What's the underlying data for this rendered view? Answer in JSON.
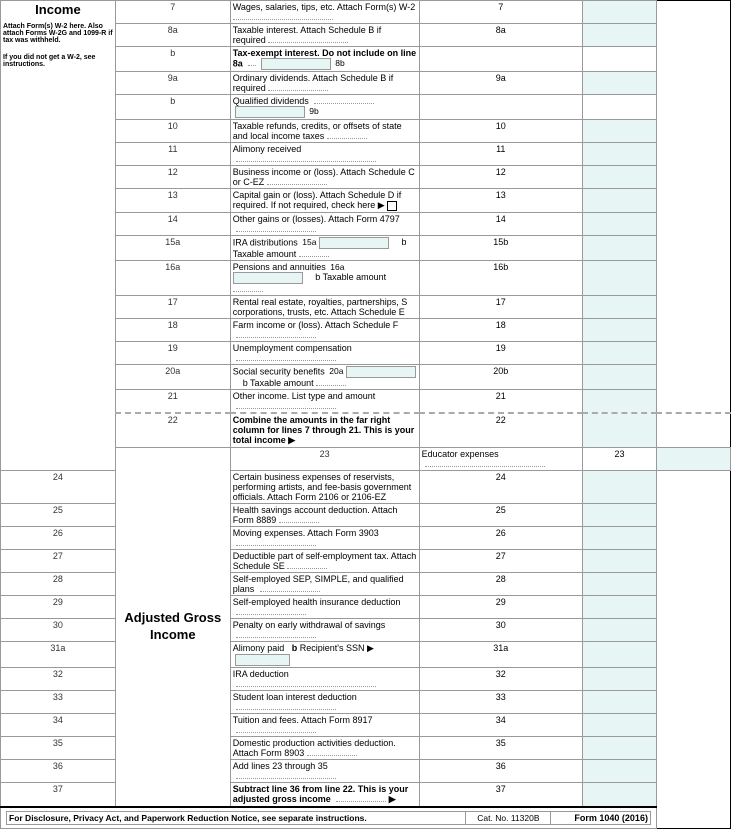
{
  "form": {
    "title": "Form 1040 (2016)",
    "catno": "Cat. No. 11320B",
    "footer_text": "For Disclosure, Privacy Act, and Paperwork Reduction Notice, see separate instructions."
  },
  "sections": {
    "income": {
      "label": "Income",
      "attach_note": "Attach Form(s) W-2 here. Also attach Forms W-2G and 1099-R if tax was withheld.",
      "w2_note": "If you did not get a W-2, see instructions."
    },
    "agi": {
      "label": "Adjusted Gross Income"
    }
  },
  "lines": [
    {
      "num": "7",
      "col_a": "",
      "desc": "Wages, salaries, tips, etc. Attach Form(s) W-2",
      "result_col": "7"
    },
    {
      "num": "8a",
      "col_a": "",
      "desc": "Taxable interest. Attach Schedule B if required",
      "result_col": "8a"
    },
    {
      "num": "b",
      "col_a": "8b",
      "desc": "Tax-exempt interest. Do not include on line 8a",
      "has_inline": true,
      "inline_label": "8b",
      "result_col": ""
    },
    {
      "num": "9a",
      "col_a": "",
      "desc": "Ordinary dividends. Attach Schedule B if required",
      "result_col": "9a"
    },
    {
      "num": "b",
      "col_a": "9b",
      "desc": "Qualified dividends",
      "has_inline": true,
      "inline_label": "9b",
      "result_col": ""
    },
    {
      "num": "10",
      "col_a": "",
      "desc": "Taxable refunds, credits, or offsets of state and local income taxes",
      "result_col": "10"
    },
    {
      "num": "11",
      "col_a": "",
      "desc": "Alimony received",
      "result_col": "11"
    },
    {
      "num": "12",
      "col_a": "",
      "desc": "Business income or (loss). Attach Schedule C or C-EZ",
      "result_col": "12"
    },
    {
      "num": "13",
      "col_a": "",
      "desc": "Capital gain or (loss). Attach Schedule D if required. If not required, check here ▶",
      "has_checkbox": true,
      "result_col": "13"
    },
    {
      "num": "14",
      "col_a": "",
      "desc": "Other gains or (losses). Attach Form 4797",
      "result_col": "14"
    },
    {
      "num": "15a",
      "col_a": "15a",
      "desc": "IRA distributions",
      "has_left_input": true,
      "right_label": "b Taxable amount",
      "result_col": "15b"
    },
    {
      "num": "16a",
      "col_a": "16a",
      "desc": "Pensions and annuities",
      "has_left_input": true,
      "right_label": "b Taxable amount",
      "result_col": "16b"
    },
    {
      "num": "17",
      "col_a": "",
      "desc": "Rental real estate, royalties, partnerships, S corporations, trusts, etc. Attach Schedule E",
      "result_col": "17"
    },
    {
      "num": "18",
      "col_a": "",
      "desc": "Farm income or (loss). Attach Schedule F",
      "result_col": "18"
    },
    {
      "num": "19",
      "col_a": "",
      "desc": "Unemployment compensation",
      "result_col": "19"
    },
    {
      "num": "20a",
      "col_a": "20a",
      "desc": "Social security benefits",
      "has_left_input": true,
      "right_label": "b Taxable amount",
      "result_col": "20b"
    },
    {
      "num": "21",
      "col_a": "",
      "desc": "Other income. List type and amount",
      "result_col": "21"
    },
    {
      "num": "22",
      "col_a": "",
      "desc": "Combine the amounts in the far right column for lines 7 through 21. This is your total income ▶",
      "result_col": "22",
      "bold_desc": true
    },
    {
      "num": "23",
      "col_a": "",
      "desc": "Educator expenses",
      "result_col": "23",
      "agi": true
    },
    {
      "num": "24",
      "col_a": "",
      "desc": "Certain business expenses of reservists, performing artists, and fee-basis government officials. Attach Form 2106 or 2106-EZ",
      "result_col": "24",
      "agi": true
    },
    {
      "num": "25",
      "col_a": "",
      "desc": "Health savings account deduction. Attach Form 8889",
      "result_col": "25",
      "agi": true
    },
    {
      "num": "26",
      "col_a": "",
      "desc": "Moving expenses. Attach Form 3903",
      "result_col": "26",
      "agi": true
    },
    {
      "num": "27",
      "col_a": "",
      "desc": "Deductible part of self-employment tax. Attach Schedule SE",
      "result_col": "27",
      "agi": true
    },
    {
      "num": "28",
      "col_a": "",
      "desc": "Self-employed SEP, SIMPLE, and qualified plans",
      "result_col": "28",
      "agi": true
    },
    {
      "num": "29",
      "col_a": "",
      "desc": "Self-employed health insurance deduction",
      "result_col": "29",
      "agi": true
    },
    {
      "num": "30",
      "col_a": "",
      "desc": "Penalty on early withdrawal of savings",
      "result_col": "30",
      "agi": true
    },
    {
      "num": "31a",
      "col_a": "31a",
      "desc": "Alimony paid",
      "right_label": "b Recipient's SSN ▶",
      "has_ssn": true,
      "result_col": "31a",
      "agi": true
    },
    {
      "num": "32",
      "col_a": "",
      "desc": "IRA deduction",
      "result_col": "32",
      "agi": true
    },
    {
      "num": "33",
      "col_a": "",
      "desc": "Student loan interest deduction",
      "result_col": "33",
      "agi": true
    },
    {
      "num": "34",
      "col_a": "",
      "desc": "Tuition and fees. Attach Form 8917",
      "result_col": "34",
      "agi": true
    },
    {
      "num": "35",
      "col_a": "",
      "desc": "Domestic production activities deduction. Attach Form 8903",
      "result_col": "35",
      "agi": true
    },
    {
      "num": "36",
      "col_a": "",
      "desc": "Add lines 23 through 35",
      "result_col": "36",
      "agi": true
    },
    {
      "num": "37",
      "col_a": "",
      "desc": "Subtract line 36 from line 22. This is your adjusted gross income",
      "result_col": "37",
      "agi": true,
      "bold_desc": true,
      "arrow": true
    }
  ]
}
